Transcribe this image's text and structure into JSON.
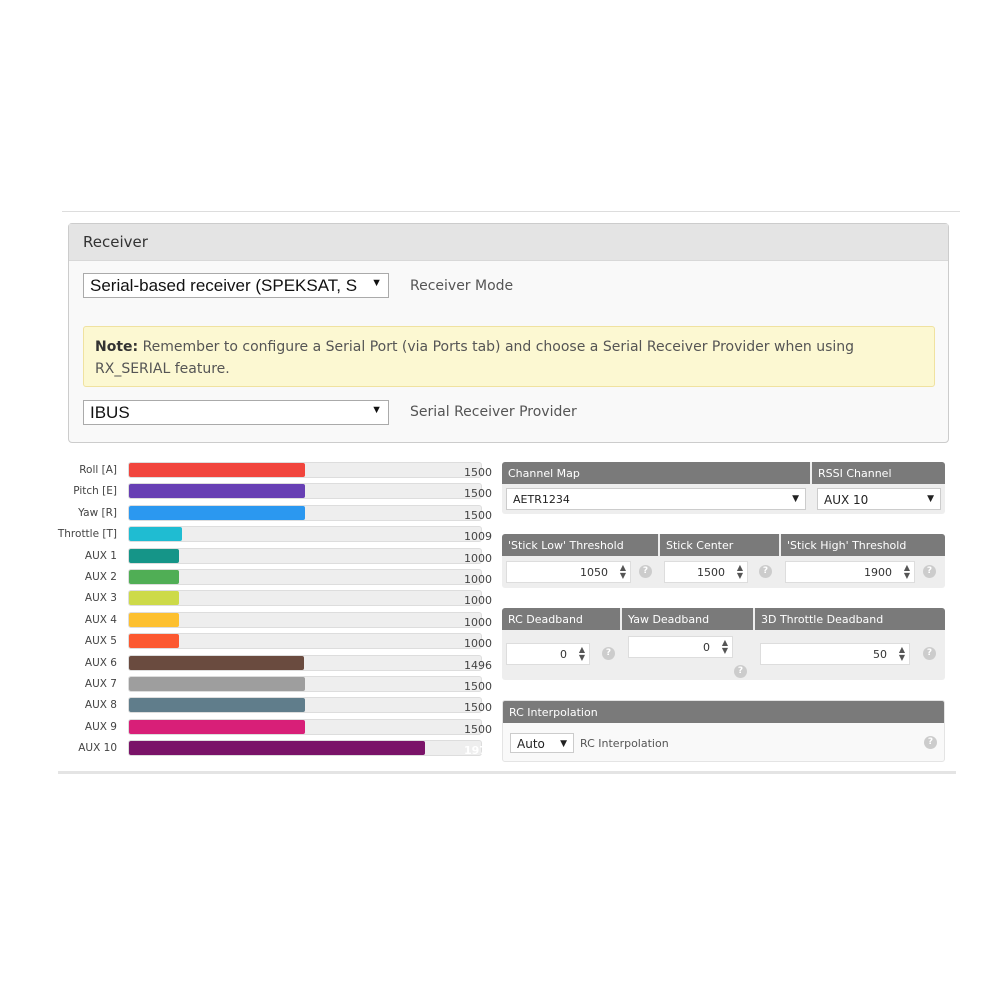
{
  "receiver": {
    "title": "Receiver",
    "mode_value": "Serial-based receiver (SPEKSAT, S",
    "mode_label": "Receiver Mode",
    "note_bold": "Note:",
    "note_text": " Remember to configure a Serial Port (via Ports tab) and choose a Serial Receiver Provider when using RX_SERIAL feature.",
    "provider_value": "IBUS",
    "provider_label": "Serial Receiver Provider"
  },
  "chart_data": {
    "type": "bar",
    "orientation": "horizontal",
    "xlim": [
      800,
      2200
    ],
    "categories": [
      "Roll [A]",
      "Pitch [E]",
      "Yaw [R]",
      "Throttle [T]",
      "AUX 1",
      "AUX 2",
      "AUX 3",
      "AUX 4",
      "AUX 5",
      "AUX 6",
      "AUX 7",
      "AUX 8",
      "AUX 9",
      "AUX 10"
    ],
    "values": [
      1500,
      1500,
      1500,
      1009,
      1000,
      1000,
      1000,
      1000,
      1000,
      1496,
      1500,
      1500,
      1500,
      1977
    ],
    "colors": [
      "#f1453d",
      "#673fb4",
      "#2b98f0",
      "#1fbcd2",
      "#159588",
      "#50ae55",
      "#cdda49",
      "#fdc02f",
      "#fc5830",
      "#6a4b3f",
      "#9e9e9e",
      "#607d8b",
      "#d81f78",
      "#7a1368"
    ]
  },
  "channel_map": {
    "label": "Channel Map",
    "value": "AETR1234",
    "rssi_label": "RSSI Channel",
    "rssi_value": "AUX 10"
  },
  "stick": {
    "low_label": "'Stick Low' Threshold",
    "low": "1050",
    "center_label": "Stick Center",
    "center": "1500",
    "high_label": "'Stick High' Threshold",
    "high": "1900"
  },
  "deadband": {
    "rc_label": "RC Deadband",
    "rc": "0",
    "yaw_label": "Yaw Deadband",
    "yaw": "0",
    "throttle_label": "3D Throttle Deadband",
    "throttle": "50"
  },
  "interp": {
    "header": "RC Interpolation",
    "value": "Auto",
    "label": "RC Interpolation"
  },
  "icons": {
    "help": "?",
    "spinner": "▲▼",
    "dropdown": "▼"
  }
}
